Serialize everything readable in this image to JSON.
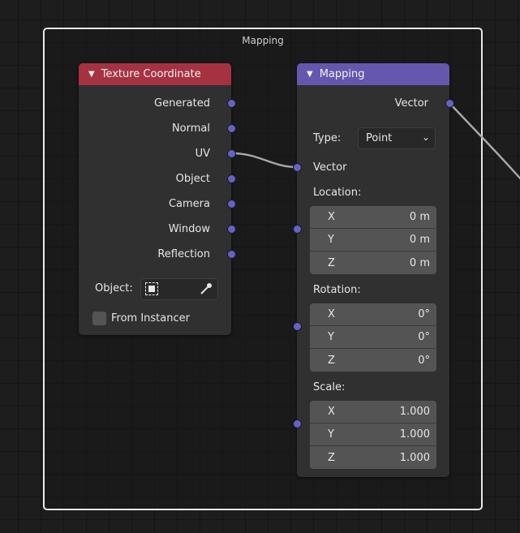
{
  "frame": {
    "label": "Mapping"
  },
  "texture_coordinate": {
    "title": "Texture Coordinate",
    "header_color": "#a63241",
    "outputs": [
      "Generated",
      "Normal",
      "UV",
      "Object",
      "Camera",
      "Window",
      "Reflection"
    ],
    "object_label": "Object:",
    "from_instancer_label": "From Instancer",
    "from_instancer_checked": false
  },
  "mapping": {
    "title": "Mapping",
    "header_color": "#6557ad",
    "output_label": "Vector",
    "type_label": "Type:",
    "type_value": "Point",
    "input_vector_label": "Vector",
    "location": {
      "label": "Location:",
      "x": "0 m",
      "y": "0 m",
      "z": "0 m"
    },
    "rotation": {
      "label": "Rotation:",
      "x": "0°",
      "y": "0°",
      "z": "0°"
    },
    "scale": {
      "label": "Scale:",
      "x": "1.000",
      "y": "1.000",
      "z": "1.000"
    },
    "axis_labels": {
      "x": "X",
      "y": "Y",
      "z": "Z"
    }
  },
  "socket_color": "#6363c7",
  "icons": {
    "collapse": "triangle-down-icon",
    "dropdown": "chevron-down-icon",
    "object_type": "object-icon",
    "eyedropper": "eyedropper-icon"
  }
}
